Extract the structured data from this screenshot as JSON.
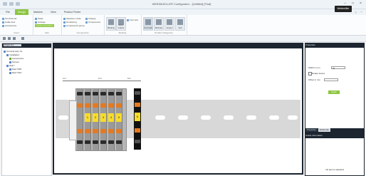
{
  "window": {
    "title": "WEIDMUELLER Configurator - [Untitled] [Trial]",
    "controls": [
      "–",
      "□",
      "×"
    ]
  },
  "brand": {
    "logo": "Weidmüller"
  },
  "ribbon": {
    "tabs": [
      {
        "label": "File",
        "active": false
      },
      {
        "label": "Design",
        "active": true
      },
      {
        "label": "Markers",
        "active": false
      },
      {
        "label": "View",
        "active": false
      },
      {
        "label": "Product Finder",
        "active": false
      }
    ],
    "groups": [
      {
        "label": "Insert",
        "items": [
          "Terminal rail",
          "Cable duct",
          "Accessories"
        ]
      },
      {
        "label": "Edit",
        "items": [
          "Paste",
          "Arrange",
          "Cross-connection"
        ]
      },
      {
        "label": "Components",
        "items": [
          "Selection mode",
          "Numbering",
          "Components group",
          "Change",
          "Components"
        ]
      },
      {
        "label": "Marking",
        "items": [
          "Marking",
          "Auto-marker",
          "Font size"
        ]
      },
      {
        "label": "Product Categories",
        "items": [
          "Terminals",
          "Modules",
          "Jumper",
          "Test"
        ]
      }
    ]
  },
  "tree": {
    "header": "Project tree",
    "items": [
      {
        "label": "Terminal strip X1",
        "indent": 0,
        "green": false
      },
      {
        "label": "Installation",
        "indent": 1,
        "green": false
      },
      {
        "label": "Accessories",
        "indent": 2,
        "green": true
      },
      {
        "label": "Screws",
        "indent": 2,
        "green": false
      },
      {
        "label": "Rail 1",
        "indent": 1,
        "green": false
      },
      {
        "label": "Rail TS35",
        "indent": 2,
        "green": false
      },
      {
        "label": "Rail TS32",
        "indent": 2,
        "green": false
      }
    ]
  },
  "canvas": {
    "terminal_labels": [
      "1",
      "2",
      "3",
      "4",
      "5"
    ],
    "end_label": "6",
    "end_plate_label": "X1",
    "dimensions": [
      "10.0",
      "40.5",
      "50.0"
    ]
  },
  "properties": {
    "header": "Properties",
    "width_label": "Width in mm",
    "width_value": "35",
    "checkbox_label": "Rotate device",
    "offset_label": "Offset in mm",
    "apply_label": "Apply"
  },
  "panel_tabs": [
    "Properties",
    "Article info"
  ],
  "info": {
    "header": "Article information",
    "message": "No item is selected"
  }
}
